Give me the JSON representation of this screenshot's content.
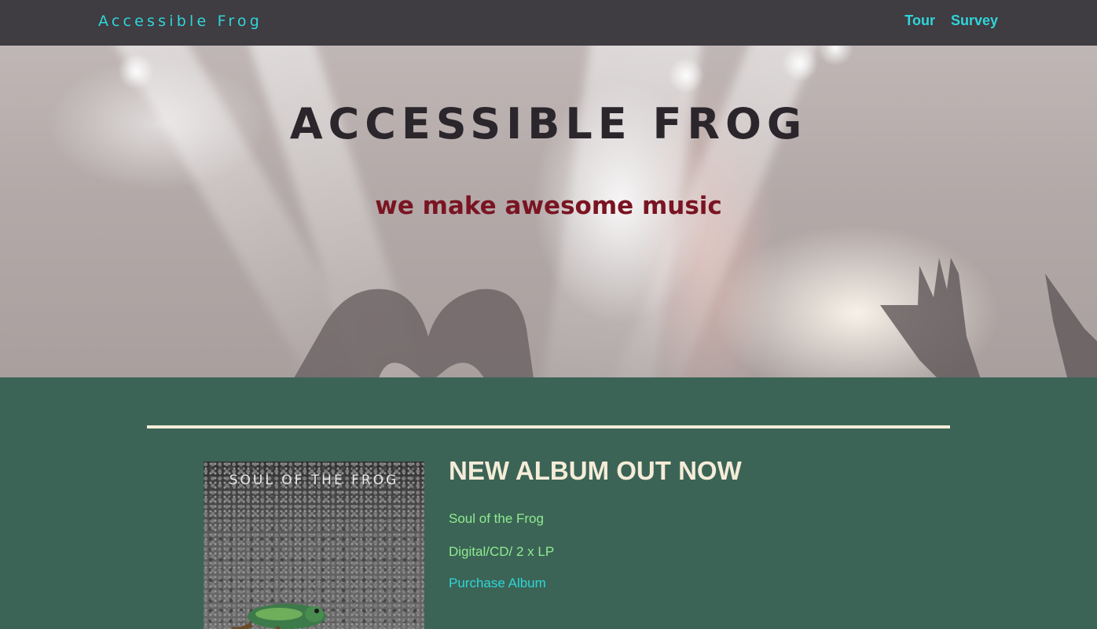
{
  "navbar": {
    "brand": "Accessible Frog",
    "links": [
      {
        "label": "Tour"
      },
      {
        "label": "Survey"
      }
    ]
  },
  "hero": {
    "title": "ACCESSIBLE FROG",
    "subtitle": "we make awesome music"
  },
  "album": {
    "cover_title": "SOUL OF THE FROG",
    "heading": "NEW ALBUM OUT NOW",
    "name": "Soul of the Frog",
    "formats": "Digital/CD/ 2 x LP",
    "purchase_label": "Purchase Album"
  },
  "colors": {
    "navbar_bg": "#3f3c42",
    "accent_cyan": "#2fd6d8",
    "main_bg": "#3b6456",
    "heading_cream": "#f5ecd8",
    "text_green": "#90ec90",
    "subtitle_red": "#7a1422"
  }
}
